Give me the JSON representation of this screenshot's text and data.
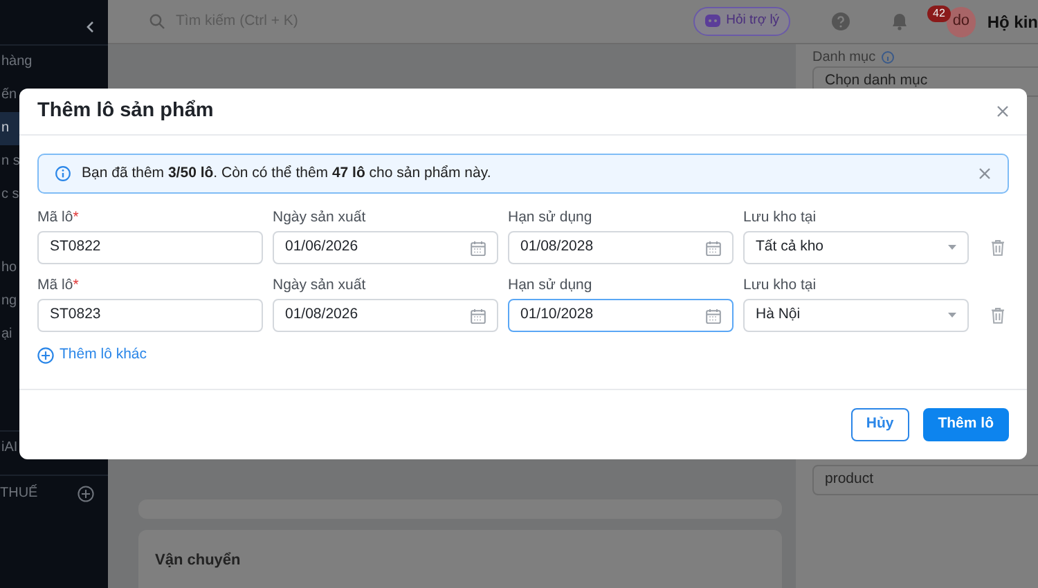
{
  "sidebar": {
    "items": [
      {
        "label": "hàng",
        "selected": false
      },
      {
        "label": "ến",
        "selected": false
      },
      {
        "label": "n",
        "selected": true
      },
      {
        "label": "n s",
        "selected": false
      },
      {
        "label": "c s",
        "selected": false
      },
      {
        "label": "ho",
        "selected": false
      },
      {
        "label": "ng",
        "selected": false
      },
      {
        "label": "ại",
        "selected": false
      },
      {
        "label": "iAI",
        "selected": false
      }
    ],
    "section": {
      "label": "THUẾ"
    }
  },
  "topbar": {
    "search": {
      "placeholder": "Tìm kiếm (Ctrl + K)"
    },
    "assistant": "Hỏi trợ lý",
    "notifications": "42",
    "avatar": "do",
    "user": "Hộ kin"
  },
  "page": {
    "category": {
      "label": "Danh mục",
      "placeholder": "Chọn danh mục"
    },
    "tag_value": "product",
    "shipping_title": "Vận chuyển"
  },
  "modal": {
    "title": "Thêm lô sản phẩm",
    "alert": "Bạn đã thêm **3/50 lô**. Còn có thể thêm **47 lô** cho sản phẩm này.",
    "rows": [
      {
        "fields": [
          {
            "kind": "text",
            "label": "Mã lô",
            "required_mark": "*",
            "value": "ST0822",
            "focused": false
          },
          {
            "kind": "date",
            "label": "Ngày sản xuất",
            "value": "01/06/2026",
            "focused": false
          },
          {
            "kind": "date",
            "label": "Hạn sử dụng",
            "value": "01/08/2028",
            "focused": false
          },
          {
            "kind": "select",
            "label": "Lưu kho tại",
            "value": "Tất cả kho",
            "focused": false
          }
        ]
      },
      {
        "fields": [
          {
            "kind": "text",
            "label": "Mã lô",
            "required_mark": "*",
            "value": "ST0823",
            "focused": false
          },
          {
            "kind": "date",
            "label": "Ngày sản xuất",
            "value": "01/08/2026",
            "focused": false
          },
          {
            "kind": "date",
            "label": "Hạn sử dụng",
            "value": "01/10/2028",
            "focused": true
          },
          {
            "kind": "select",
            "label": "Lưu kho tại",
            "value": "Hà Nội",
            "focused": false
          }
        ]
      }
    ],
    "add_link": "Thêm lô khác",
    "buttons": [
      {
        "kind": "secondary",
        "label": "Hủy"
      },
      {
        "kind": "primary",
        "label": "Thêm lô"
      }
    ]
  }
}
